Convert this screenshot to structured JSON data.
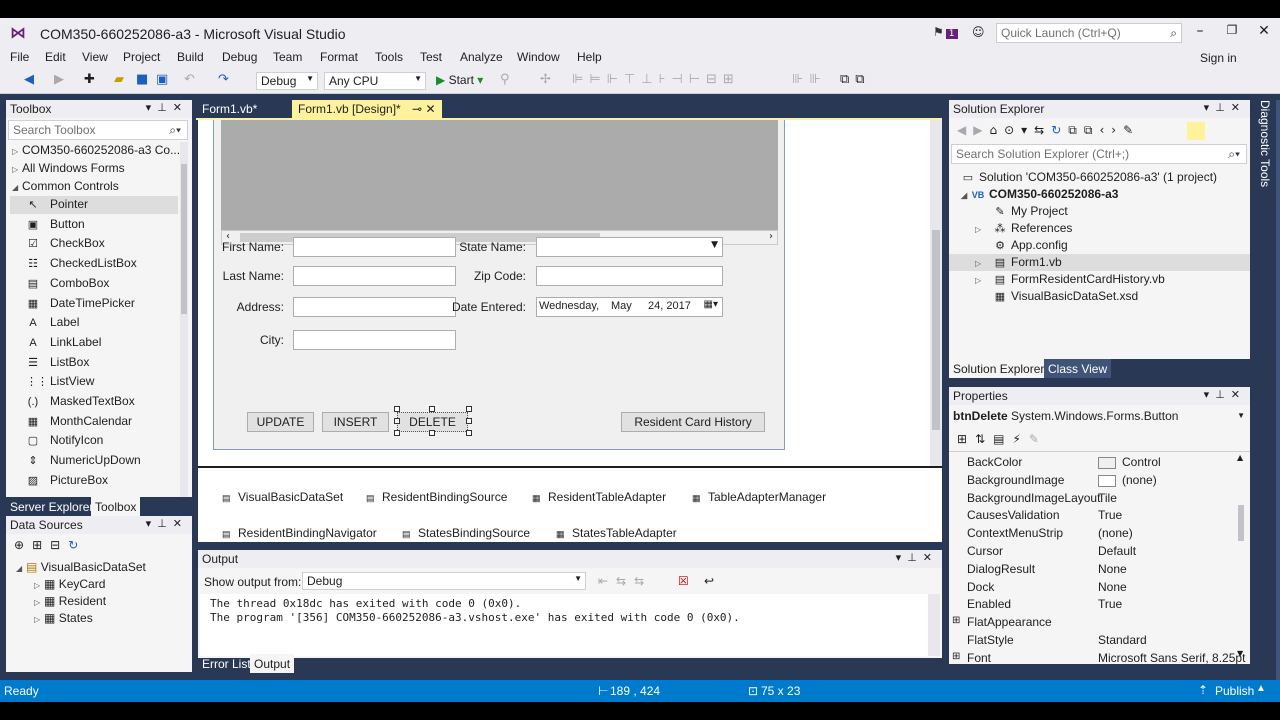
{
  "window": {
    "title": "COM350-660252086-a3 - Microsoft Visual Studio",
    "notification_count": "1",
    "quick_launch_placeholder": "Quick Launch (Ctrl+Q)"
  },
  "menu": [
    "File",
    "Edit",
    "View",
    "Project",
    "Build",
    "Debug",
    "Team",
    "Format",
    "Tools",
    "Test",
    "Analyze",
    "Window",
    "Help"
  ],
  "sign_in": "Sign in",
  "toolbar": {
    "config": "Debug",
    "platform": "Any CPU",
    "start": "Start"
  },
  "editor_tabs": [
    {
      "label": "Form1.vb*"
    },
    {
      "label": "Form1.vb [Design]*"
    }
  ],
  "toolbox": {
    "title": "Toolbox",
    "search_placeholder": "Search Toolbox",
    "groups": [
      "COM350-660252086-a3 Co...",
      "All Windows Forms",
      "Common Controls"
    ],
    "items": [
      {
        "label": "Pointer",
        "icon": "pointer-icon",
        "glyph": "↖"
      },
      {
        "label": "Button",
        "icon": "button-icon",
        "glyph": "▣"
      },
      {
        "label": "CheckBox",
        "icon": "checkbox-icon",
        "glyph": "☑"
      },
      {
        "label": "CheckedListBox",
        "icon": "checkedlistbox-icon",
        "glyph": "☷"
      },
      {
        "label": "ComboBox",
        "icon": "combobox-icon",
        "glyph": "▤"
      },
      {
        "label": "DateTimePicker",
        "icon": "datetimepicker-icon",
        "glyph": "▦"
      },
      {
        "label": "Label",
        "icon": "label-icon",
        "glyph": "A"
      },
      {
        "label": "LinkLabel",
        "icon": "linklabel-icon",
        "glyph": "A"
      },
      {
        "label": "ListBox",
        "icon": "listbox-icon",
        "glyph": "☰"
      },
      {
        "label": "ListView",
        "icon": "listview-icon",
        "glyph": "⋮⋮"
      },
      {
        "label": "MaskedTextBox",
        "icon": "maskedtextbox-icon",
        "glyph": "(.)"
      },
      {
        "label": "MonthCalendar",
        "icon": "monthcalendar-icon",
        "glyph": "▦"
      },
      {
        "label": "NotifyIcon",
        "icon": "notifyicon-icon",
        "glyph": "▢"
      },
      {
        "label": "NumericUpDown",
        "icon": "numericupdown-icon",
        "glyph": "⇕"
      },
      {
        "label": "PictureBox",
        "icon": "picturebox-icon",
        "glyph": "▨"
      }
    ],
    "bottom_tabs": [
      "Server Explorer",
      "Toolbox"
    ]
  },
  "data_sources": {
    "title": "Data Sources",
    "root": "VisualBasicDataSet",
    "tables": [
      "KeyCard",
      "Resident",
      "States"
    ]
  },
  "form": {
    "labels": {
      "first_name": "First Name:",
      "last_name": "Last Name:",
      "address": "Address:",
      "city": "City:",
      "state_name": "State Name:",
      "zip_code": "Zip Code:",
      "date_entered": "Date Entered:"
    },
    "date_value": {
      "day": "Wednesday,",
      "month": "May",
      "date": "24, 2017"
    },
    "buttons": {
      "update": "UPDATE",
      "insert": "INSERT",
      "delete": "DELETE",
      "history": "Resident Card History"
    }
  },
  "tray": [
    "VisualBasicDataSet",
    "ResidentBindingSource",
    "ResidentTableAdapter",
    "TableAdapterManager",
    "ResidentBindingNavigator",
    "StatesBindingSource",
    "StatesTableAdapter"
  ],
  "output": {
    "title": "Output",
    "show_from_label": "Show output from:",
    "show_from_value": "Debug",
    "lines": [
      "The thread 0x18dc has exited with code 0 (0x0).",
      "The program '[356] COM350-660252086-a3.vshost.exe' has exited with code 0 (0x0)."
    ],
    "tabs": [
      "Error List",
      "Output"
    ]
  },
  "solution_explorer": {
    "title": "Solution Explorer",
    "search_placeholder": "Search Solution Explorer (Ctrl+;)",
    "solution": "Solution 'COM350-660252086-a3' (1 project)",
    "project": "COM350-660252086-a3",
    "items": [
      "My Project",
      "References",
      "App.config",
      "Form1.vb",
      "FormResidentCardHistory.vb",
      "VisualBasicDataSet.xsd"
    ],
    "tabs": [
      "Solution Explorer",
      "Class View"
    ]
  },
  "properties": {
    "title": "Properties",
    "object_name": "btnDelete",
    "object_type": "System.Windows.Forms.Button",
    "rows": [
      {
        "name": "BackColor",
        "value": "Control"
      },
      {
        "name": "BackgroundImage",
        "value": "(none)"
      },
      {
        "name": "BackgroundImageLayout",
        "value": "Tile"
      },
      {
        "name": "CausesValidation",
        "value": "True"
      },
      {
        "name": "ContextMenuStrip",
        "value": "(none)"
      },
      {
        "name": "Cursor",
        "value": "Default"
      },
      {
        "name": "DialogResult",
        "value": "None"
      },
      {
        "name": "Dock",
        "value": "None"
      },
      {
        "name": "Enabled",
        "value": "True"
      },
      {
        "name": "FlatAppearance",
        "value": ""
      },
      {
        "name": "FlatStyle",
        "value": "Standard"
      },
      {
        "name": "Font",
        "value": "Microsoft Sans Serif, 8.25pt"
      }
    ]
  },
  "diagnostic_tools": "Diagnostic Tools",
  "status": {
    "ready": "Ready",
    "position": "189 , 424",
    "size": "75 x 23",
    "publish": "Publish"
  }
}
